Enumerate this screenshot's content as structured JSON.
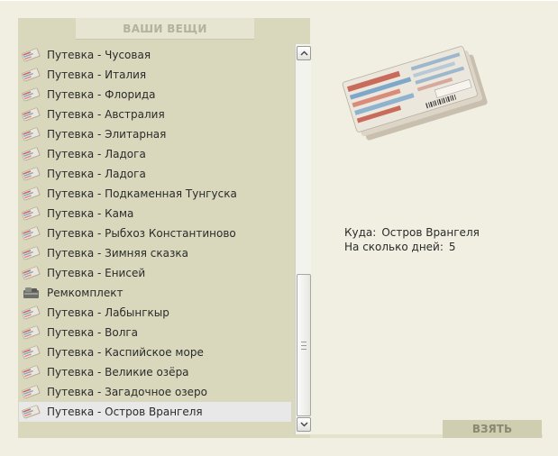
{
  "panel": {
    "title": "ВАШИ ВЕЩИ"
  },
  "items": [
    {
      "label": "Путевка - Чусовая",
      "icon": "ticket-icon",
      "selected": false
    },
    {
      "label": "Путевка - Италия",
      "icon": "ticket-icon",
      "selected": false
    },
    {
      "label": "Путевка - Флорида",
      "icon": "ticket-icon",
      "selected": false
    },
    {
      "label": "Путевка - Австралия",
      "icon": "ticket-icon",
      "selected": false
    },
    {
      "label": "Путевка - Элитарная",
      "icon": "ticket-icon",
      "selected": false
    },
    {
      "label": "Путевка - Ладога",
      "icon": "ticket-icon",
      "selected": false
    },
    {
      "label": "Путевка - Ладога",
      "icon": "ticket-icon",
      "selected": false
    },
    {
      "label": "Путевка - Подкаменная Тунгуска",
      "icon": "ticket-icon",
      "selected": false
    },
    {
      "label": "Путевка - Кама",
      "icon": "ticket-icon",
      "selected": false
    },
    {
      "label": "Путевка - Рыбхоз Константиново",
      "icon": "ticket-icon",
      "selected": false
    },
    {
      "label": "Путевка - Зимняя сказка",
      "icon": "ticket-icon",
      "selected": false
    },
    {
      "label": "Путевка - Енисей",
      "icon": "ticket-icon",
      "selected": false
    },
    {
      "label": "Ремкомплект",
      "icon": "repair-kit-icon",
      "selected": false
    },
    {
      "label": "Путевка - Лабынгкыр",
      "icon": "ticket-icon",
      "selected": false
    },
    {
      "label": "Путевка - Волга",
      "icon": "ticket-icon",
      "selected": false
    },
    {
      "label": "Путевка - Каспийское море",
      "icon": "ticket-icon",
      "selected": false
    },
    {
      "label": "Путевка - Великие озёра",
      "icon": "ticket-icon",
      "selected": false
    },
    {
      "label": "Путевка - Загадочное озеро",
      "icon": "ticket-icon",
      "selected": false
    },
    {
      "label": "Путевка - Остров Врангеля",
      "icon": "ticket-icon",
      "selected": true
    }
  ],
  "details": {
    "image_icon": "ticket-bundle-image",
    "destination_label": "Куда:",
    "destination_value": "Остров Врангеля",
    "days_label": "На сколько дней:",
    "days_value": "5"
  },
  "take_button": {
    "label": "ВЗЯТЬ"
  },
  "scrollbar": {
    "position": 0.78
  },
  "colors": {
    "background": "#f0efe2",
    "panel": "#d9d8bd",
    "selected_row": "#e8e8e8",
    "button": "#cfceb1",
    "text": "#2b2b2b"
  }
}
